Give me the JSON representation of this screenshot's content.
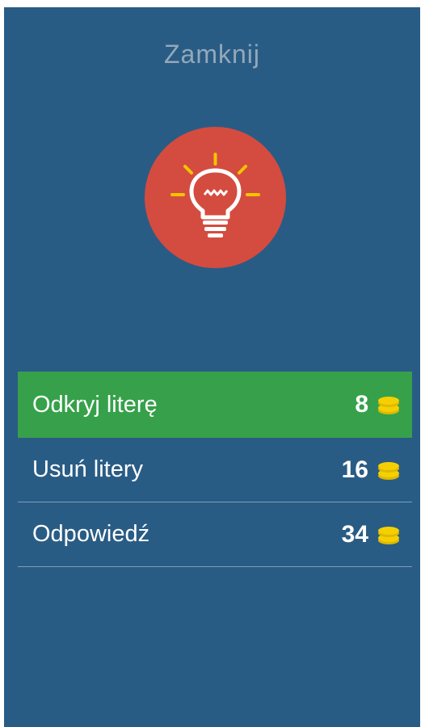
{
  "dialog": {
    "close_label": "Zamknij"
  },
  "hint_icon": "lightbulb-icon",
  "options": [
    {
      "label": "Odkryj literę",
      "cost": "8",
      "icon": "coins-icon",
      "active": true
    },
    {
      "label": "Usuń litery",
      "cost": "16",
      "icon": "coins-icon",
      "active": false
    },
    {
      "label": "Odpowiedź",
      "cost": "34",
      "icon": "coins-icon",
      "active": false
    }
  ],
  "colors": {
    "panel_bg": "#295c85",
    "active_option_bg": "#36a14a",
    "hint_circle": "#d44c3f",
    "coin": "#f5d000",
    "close_text": "#93a8ba"
  }
}
